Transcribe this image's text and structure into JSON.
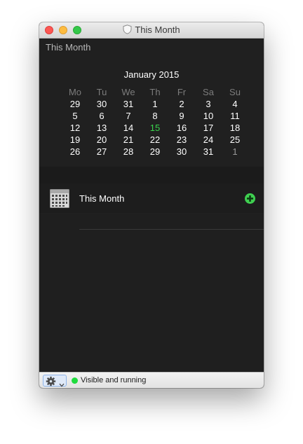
{
  "window": {
    "title": "This Month"
  },
  "header": {
    "title": "This Month"
  },
  "calendar": {
    "month_label": "January 2015",
    "weekdays": [
      "Mo",
      "Tu",
      "We",
      "Th",
      "Fr",
      "Sa",
      "Su"
    ],
    "weeks": [
      [
        "29",
        "30",
        "31",
        "1",
        "2",
        "3",
        "4"
      ],
      [
        "5",
        "6",
        "7",
        "8",
        "9",
        "10",
        "11"
      ],
      [
        "12",
        "13",
        "14",
        "15",
        "16",
        "17",
        "18"
      ],
      [
        "19",
        "20",
        "21",
        "22",
        "23",
        "24",
        "25"
      ],
      [
        "26",
        "27",
        "28",
        "29",
        "30",
        "31",
        "1"
      ]
    ],
    "today": "15",
    "today_color": "#3ad34c"
  },
  "widget": {
    "label": "This Month",
    "icon": "calendar-grid-icon",
    "add_icon": "plus-circle-icon"
  },
  "status": {
    "text": "Visible and running",
    "indicator_color": "#1fdb3e",
    "menu_icon": "gear-icon"
  }
}
